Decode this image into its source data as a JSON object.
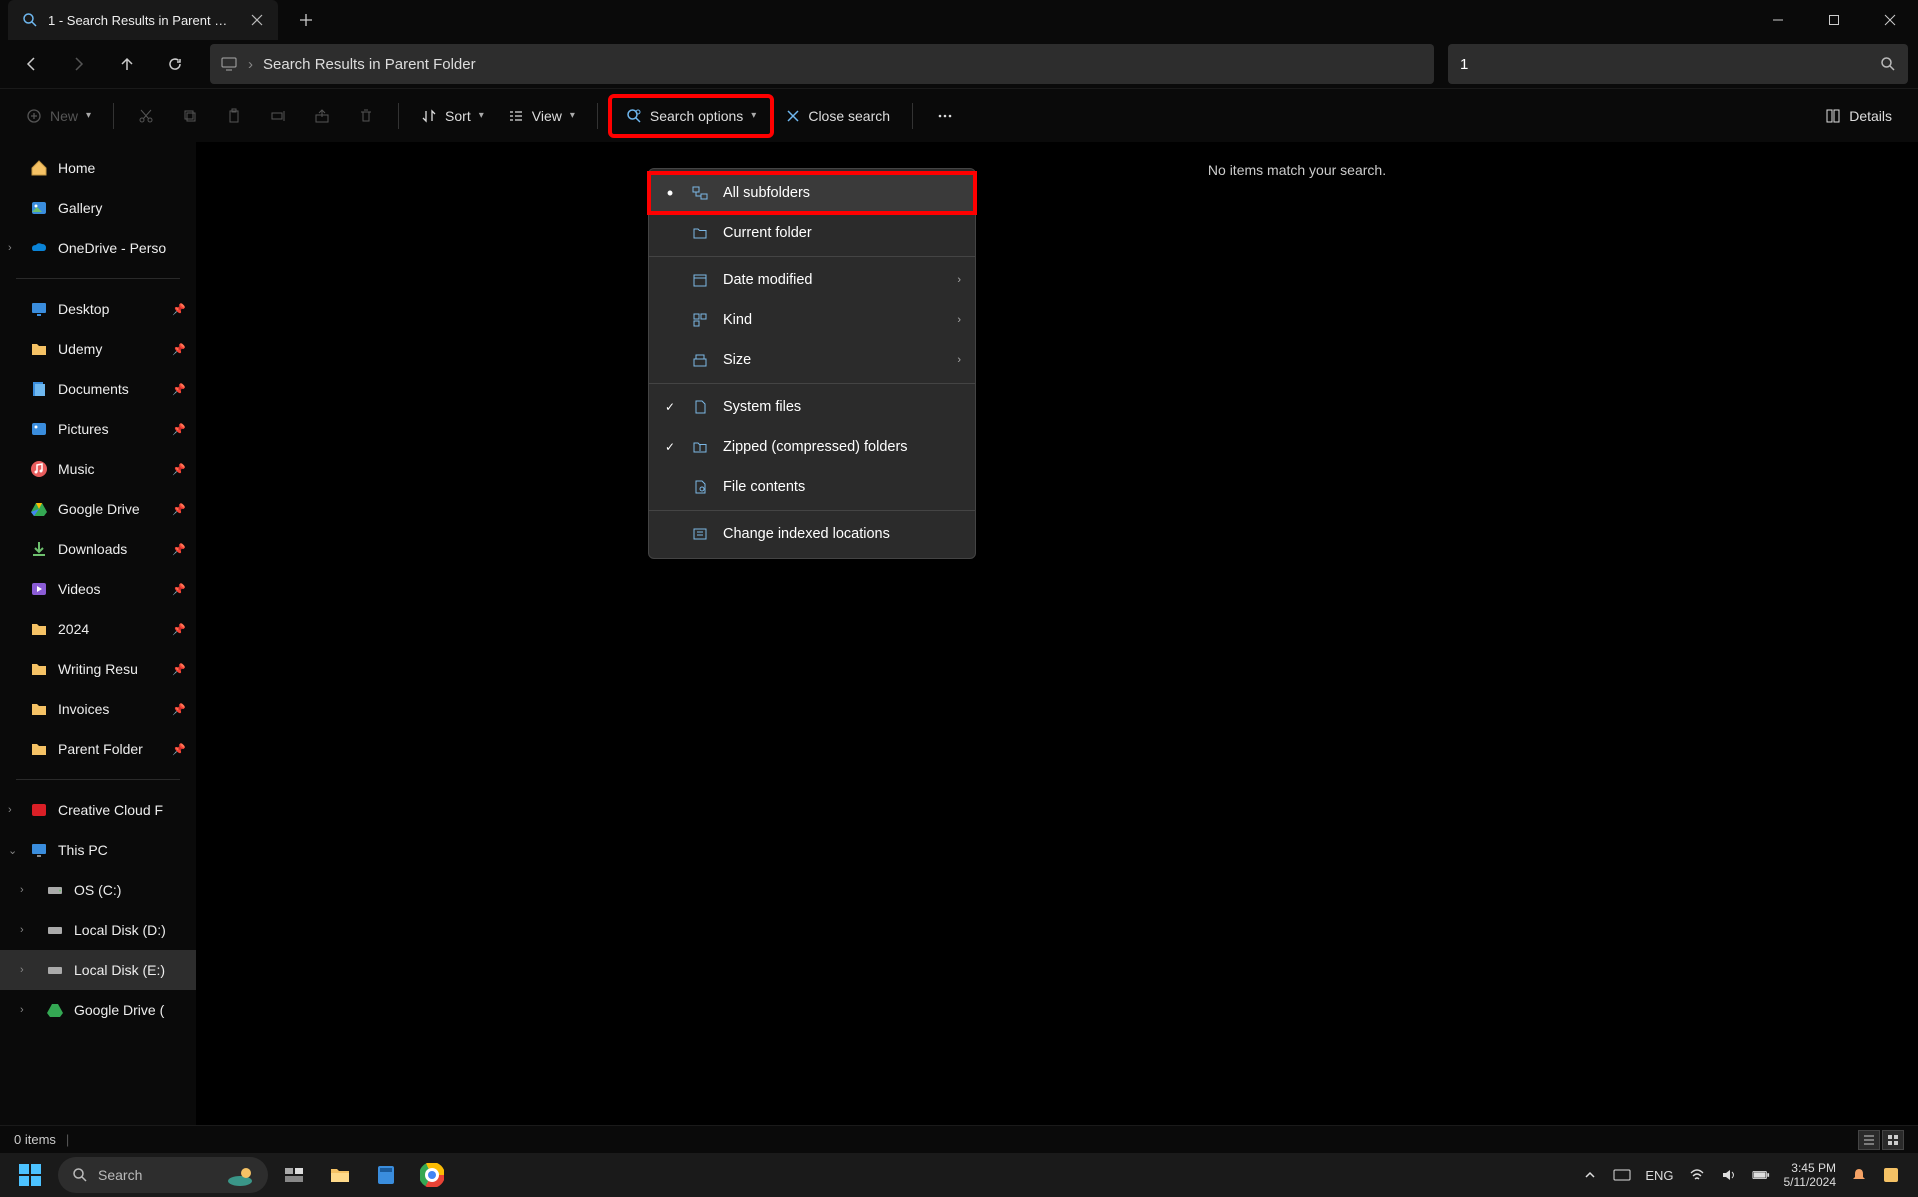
{
  "tab": {
    "title": "1 - Search Results in Parent Fol"
  },
  "address": {
    "path": "Search Results in Parent Folder"
  },
  "search": {
    "value": "1"
  },
  "toolbar": {
    "new": "New",
    "sort": "Sort",
    "view": "View",
    "search_options": "Search options",
    "close_search": "Close search",
    "details": "Details"
  },
  "dropdown": {
    "items": [
      {
        "label": "All subfolders",
        "bullet": true,
        "highlight": true
      },
      {
        "label": "Current folder"
      },
      {
        "sep": true
      },
      {
        "label": "Date modified",
        "sub": true
      },
      {
        "label": "Kind",
        "sub": true
      },
      {
        "label": "Size",
        "sub": true
      },
      {
        "sep": true
      },
      {
        "label": "System files",
        "check": true
      },
      {
        "label": "Zipped (compressed) folders",
        "check": true
      },
      {
        "label": "File contents"
      },
      {
        "sep": true
      },
      {
        "label": "Change indexed locations"
      }
    ]
  },
  "sidebar": {
    "top": [
      {
        "label": "Home",
        "icon": "home"
      },
      {
        "label": "Gallery",
        "icon": "gallery"
      },
      {
        "label": "OneDrive - Perso",
        "icon": "onedrive",
        "exp": true
      }
    ],
    "pinned": [
      {
        "label": "Desktop",
        "icon": "desktop"
      },
      {
        "label": "Udemy",
        "icon": "folder"
      },
      {
        "label": "Documents",
        "icon": "documents"
      },
      {
        "label": "Pictures",
        "icon": "pictures"
      },
      {
        "label": "Music",
        "icon": "music"
      },
      {
        "label": "Google Drive",
        "icon": "gdrive"
      },
      {
        "label": "Downloads",
        "icon": "downloads"
      },
      {
        "label": "Videos",
        "icon": "videos"
      },
      {
        "label": "2024",
        "icon": "folder"
      },
      {
        "label": "Writing Resu",
        "icon": "folder"
      },
      {
        "label": "Invoices",
        "icon": "folder"
      },
      {
        "label": "Parent Folder",
        "icon": "folder"
      }
    ],
    "bottom": [
      {
        "label": "Creative Cloud F",
        "icon": "cc",
        "exp": true
      },
      {
        "label": "This PC",
        "icon": "pc",
        "exp": true,
        "expanded": true
      },
      {
        "label": "OS (C:)",
        "icon": "drive",
        "exp": true,
        "indent": true
      },
      {
        "label": "Local Disk (D:)",
        "icon": "drive",
        "exp": true,
        "indent": true
      },
      {
        "label": "Local Disk (E:)",
        "icon": "drive",
        "exp": true,
        "indent": true,
        "selected": true
      },
      {
        "label": "Google Drive (",
        "icon": "gdrive",
        "exp": true,
        "indent": true
      }
    ]
  },
  "content": {
    "no_items": "No items match your search."
  },
  "status": {
    "count": "0 items"
  },
  "taskbar": {
    "search": "Search",
    "lang": "ENG",
    "time": "3:45 PM",
    "date": "5/11/2024"
  }
}
